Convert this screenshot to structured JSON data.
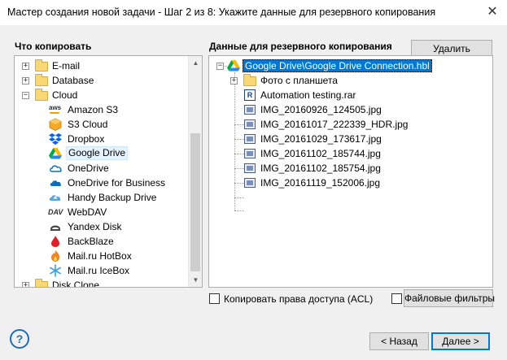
{
  "window": {
    "title": "Мастер создания новой задачи - Шаг 2 из 8: Укажите данные для резервного копирования",
    "close_glyph": "✕"
  },
  "left": {
    "heading": "Что копировать",
    "items": [
      {
        "label": "E-mail",
        "icon": "folder-icon",
        "expander": "+"
      },
      {
        "label": "Database",
        "icon": "folder-icon",
        "expander": "+"
      },
      {
        "label": "Cloud",
        "icon": "folder-icon",
        "expander": "−"
      },
      {
        "label": "Amazon S3",
        "icon": "aws-icon"
      },
      {
        "label": "S3 Cloud",
        "icon": "s3-cloud-icon"
      },
      {
        "label": "Dropbox",
        "icon": "dropbox-icon"
      },
      {
        "label": "Google Drive",
        "icon": "google-drive-icon",
        "selected": true
      },
      {
        "label": "OneDrive",
        "icon": "onedrive-icon"
      },
      {
        "label": "OneDrive for Business",
        "icon": "onedrive-business-icon"
      },
      {
        "label": "Handy Backup Drive",
        "icon": "handy-backup-drive-icon"
      },
      {
        "label": "WebDAV",
        "icon": "webdav-icon"
      },
      {
        "label": "Yandex Disk",
        "icon": "yandex-disk-icon"
      },
      {
        "label": "BackBlaze",
        "icon": "backblaze-icon"
      },
      {
        "label": "Mail.ru HotBox",
        "icon": "mailru-hotbox-icon"
      },
      {
        "label": "Mail.ru IceBox",
        "icon": "mailru-icebox-icon"
      },
      {
        "label": "Disk Clone",
        "icon": "folder-icon",
        "expander": "+"
      }
    ],
    "aws_text": "aws",
    "webdav_text": "DAV"
  },
  "right": {
    "heading": "Данные для резервного копирования",
    "delete_label": "Удалить",
    "root_label": "Google Drive\\Google Drive Connection.hbl",
    "items": [
      {
        "label": "Фото с планшета",
        "icon": "folder-icon",
        "expander": "+"
      },
      {
        "label": "Automation testing.rar",
        "icon": "rar-archive-icon"
      },
      {
        "label": "IMG_20160926_124505.jpg",
        "icon": "image-file-icon"
      },
      {
        "label": "IMG_20161017_222339_HDR.jpg",
        "icon": "image-file-icon"
      },
      {
        "label": "IMG_20161029_173617.jpg",
        "icon": "image-file-icon"
      },
      {
        "label": "IMG_20161102_185744.jpg",
        "icon": "image-file-icon"
      },
      {
        "label": "IMG_20161102_185754.jpg",
        "icon": "image-file-icon"
      },
      {
        "label": "IMG_20161119_152006.jpg",
        "icon": "image-file-icon"
      }
    ],
    "rar_glyph": "R",
    "root_expander": "−"
  },
  "options": {
    "copy_acl_label": "Копировать права доступа (ACL)",
    "file_filters_label": "Файловые фильтры"
  },
  "footer": {
    "help_glyph": "?",
    "back_label": "< Назад",
    "next_label": "Далее >"
  },
  "scroll": {
    "up": "▲",
    "down": "▼"
  }
}
